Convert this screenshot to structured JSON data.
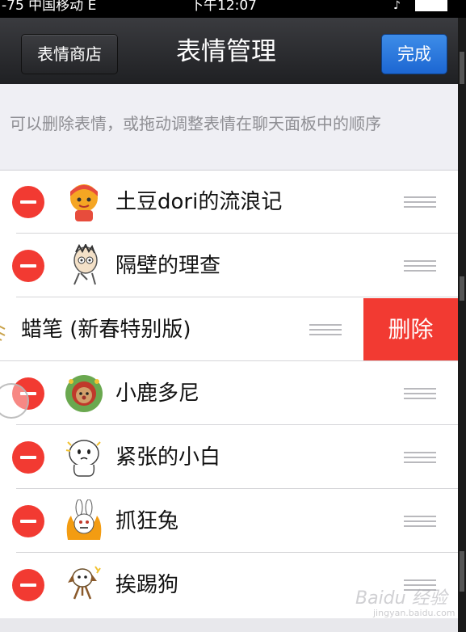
{
  "status_bar": {
    "carrier": "-75 中国移动",
    "network": "E",
    "time": "下午12:07"
  },
  "navbar": {
    "back_label": "表情商店",
    "title": "表情管理",
    "done_label": "完成"
  },
  "hint": "可以删除表情，或拖动调整表情在聊天面板中的顺序",
  "rows": [
    {
      "label": "土豆dori的流浪记",
      "icon": "potato-girl-sticker-icon"
    },
    {
      "label": "隔壁的理查",
      "icon": "richard-sticker-icon"
    },
    {
      "label": "蜡笔 (新春特别版)",
      "icon": "crayon-sticker-icon",
      "swiped": true,
      "delete_label": "删除"
    },
    {
      "label": "小鹿多尼",
      "icon": "deer-sticker-icon"
    },
    {
      "label": "紧张的小白",
      "icon": "white-ghost-sticker-icon"
    },
    {
      "label": "抓狂兔",
      "icon": "crazy-rabbit-sticker-icon"
    },
    {
      "label": "挨踢狗",
      "icon": "kicked-dog-sticker-icon"
    }
  ],
  "watermark": {
    "main": "Baidu 经验",
    "sub": "jingyan.baidu.com"
  },
  "colors": {
    "nav_background": "#2a2b2e",
    "done_button": "#2a78dd",
    "delete_red": "#f23a32",
    "page_background": "#efeff4"
  }
}
